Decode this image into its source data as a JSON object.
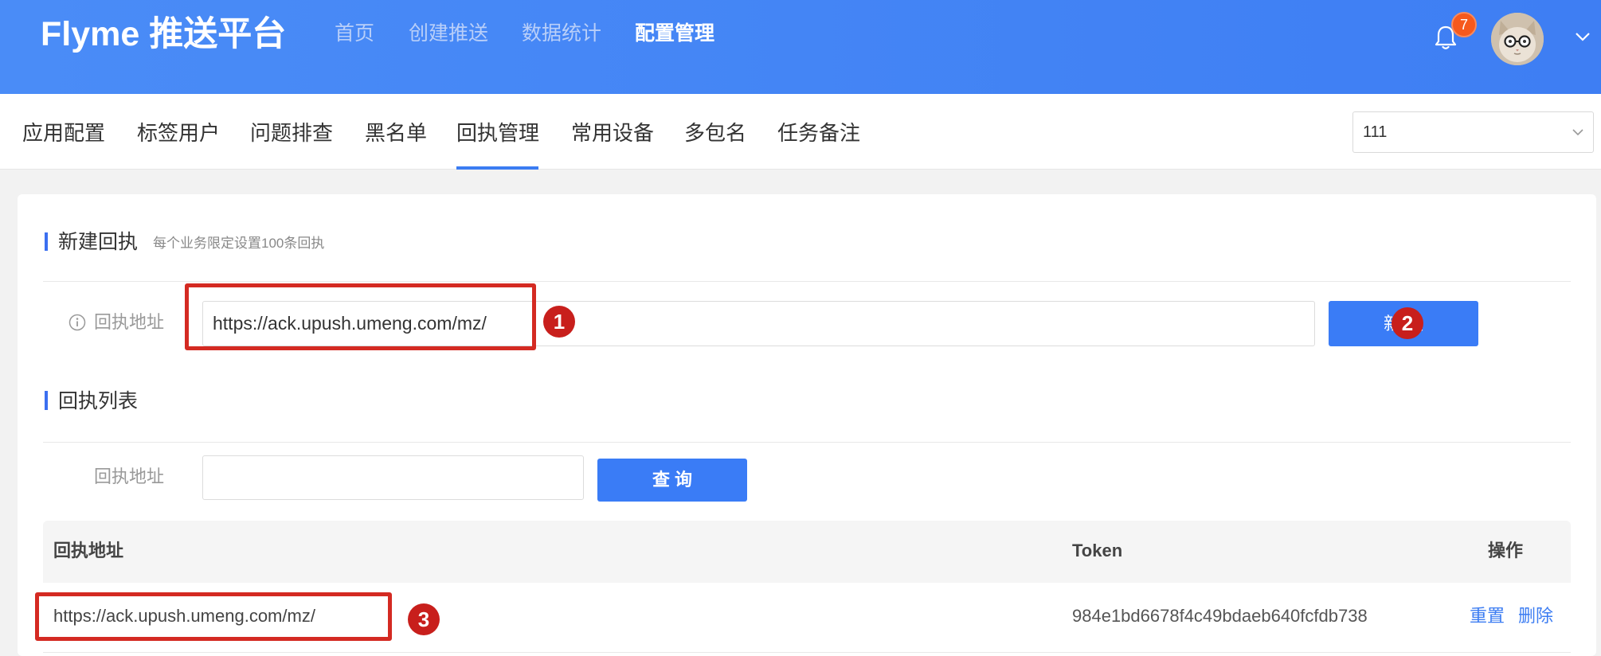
{
  "header": {
    "logo": "Flyme 推送平台",
    "nav": [
      {
        "label": "首页"
      },
      {
        "label": "创建推送"
      },
      {
        "label": "数据统计"
      },
      {
        "label": "配置管理",
        "active": true
      }
    ],
    "notification_count": "7",
    "icons": {
      "notifications": "bell-icon",
      "avatar": "cat-avatar-icon",
      "user_menu": "chevron-down-icon"
    }
  },
  "subnav": {
    "tabs": [
      {
        "label": "应用配置"
      },
      {
        "label": "标签用户"
      },
      {
        "label": "问题排查"
      },
      {
        "label": "黑名单"
      },
      {
        "label": "回执管理",
        "active": true
      },
      {
        "label": "常用设备"
      },
      {
        "label": "多包名"
      },
      {
        "label": "任务备注"
      }
    ],
    "app_select": {
      "value": "111",
      "icon": "chevron-down-icon"
    }
  },
  "new_receipt": {
    "title": "新建回执",
    "subtitle": "每个业务限定设置100条回执",
    "label": "回执地址",
    "label_icon": "info-icon",
    "input_value": "https://ack.upush.umeng.com/mz/",
    "button": "新 建"
  },
  "receipt_list": {
    "title": "回执列表",
    "filter_label": "回执地址",
    "query_button": "查 询",
    "columns": [
      "回执地址",
      "Token",
      "操作"
    ],
    "rows": [
      {
        "url": "https://ack.upush.umeng.com/mz/",
        "token": "984e1bd6678f4c49bdaeb640fcfdb738",
        "actions": [
          "重置",
          "删除"
        ]
      }
    ]
  },
  "annotations": {
    "markers": [
      "1",
      "2",
      "3"
    ]
  },
  "colors": {
    "header_blue": "#3e7ef3",
    "primary": "#3a7cf6",
    "badge": "#f6591d",
    "annotation_red": "#d42a22",
    "page_bg": "#f2f2f2"
  }
}
